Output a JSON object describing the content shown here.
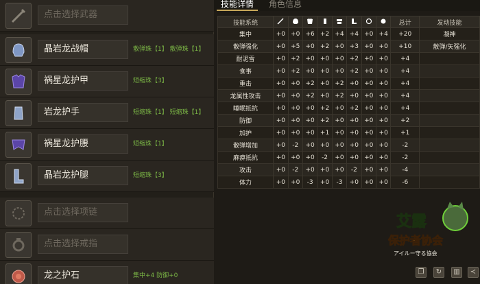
{
  "equipment": [
    {
      "name": "点击选择武器",
      "empty": true,
      "deco": ""
    },
    {
      "name": "晶岩龙战帽",
      "empty": false,
      "deco": "散弹珠【1】 散弹珠【1】"
    },
    {
      "name": "祸星龙护甲",
      "empty": false,
      "deco": "短缩珠【3】"
    },
    {
      "name": "岩龙护手",
      "empty": false,
      "deco": "短缩珠【1】 短缩珠【1】"
    },
    {
      "name": "祸星龙护腰",
      "empty": false,
      "deco": "短缩珠【1】"
    },
    {
      "name": "晶岩龙护腿",
      "empty": false,
      "deco": "短缩珠【3】"
    },
    {
      "name": "点击选择项链",
      "empty": true,
      "deco": ""
    },
    {
      "name": "点击选择戒指",
      "empty": true,
      "deco": ""
    },
    {
      "name": "龙之护石",
      "empty": false,
      "deco": "集中+4 防御+0"
    }
  ],
  "tabs": {
    "active": "技能详情",
    "inactive": "角色信息"
  },
  "table": {
    "header_skill": "技能系统",
    "header_total": "总计",
    "header_activation": "发动技能",
    "part_icons": [
      "weapon-icon",
      "helmet-icon",
      "armor-icon",
      "gloves-icon",
      "waist-icon",
      "legs-icon",
      "talisman-icon",
      "necklace-icon"
    ],
    "rows": [
      {
        "skill": "集中",
        "parts": [
          "+0",
          "+0",
          "+6",
          "+2",
          "+4",
          "+4",
          "+0",
          "+4"
        ],
        "total": "+20",
        "activation": "凝神"
      },
      {
        "skill": "散弹强化",
        "parts": [
          "+0",
          "+5",
          "+0",
          "+2",
          "+0",
          "+3",
          "+0",
          "+0"
        ],
        "total": "+10",
        "activation": "散弹/矢强化"
      },
      {
        "skill": "耐泥雪",
        "parts": [
          "+0",
          "+2",
          "+0",
          "+0",
          "+0",
          "+2",
          "+0",
          "+0"
        ],
        "total": "+4",
        "activation": ""
      },
      {
        "skill": "食事",
        "parts": [
          "+0",
          "+2",
          "+0",
          "+0",
          "+0",
          "+2",
          "+0",
          "+0"
        ],
        "total": "+4",
        "activation": ""
      },
      {
        "skill": "重击",
        "parts": [
          "+0",
          "+0",
          "+2",
          "+0",
          "+2",
          "+0",
          "+0",
          "+0"
        ],
        "total": "+4",
        "activation": ""
      },
      {
        "skill": "龙属性攻击",
        "parts": [
          "+0",
          "+0",
          "+2",
          "+0",
          "+2",
          "+0",
          "+0",
          "+0"
        ],
        "total": "+4",
        "activation": ""
      },
      {
        "skill": "睡眠抵抗",
        "parts": [
          "+0",
          "+0",
          "+0",
          "+2",
          "+0",
          "+2",
          "+0",
          "+0"
        ],
        "total": "+4",
        "activation": ""
      },
      {
        "skill": "防御",
        "parts": [
          "+0",
          "+0",
          "+0",
          "+2",
          "+0",
          "+0",
          "+0",
          "+0"
        ],
        "total": "+2",
        "activation": ""
      },
      {
        "skill": "加护",
        "parts": [
          "+0",
          "+0",
          "+0",
          "+1",
          "+0",
          "+0",
          "+0",
          "+0"
        ],
        "total": "+1",
        "activation": ""
      },
      {
        "skill": "散弹增加",
        "parts": [
          "+0",
          "-2",
          "+0",
          "+0",
          "+0",
          "+0",
          "+0",
          "+0"
        ],
        "total": "-2",
        "activation": ""
      },
      {
        "skill": "麻痹抵抗",
        "parts": [
          "+0",
          "+0",
          "+0",
          "-2",
          "+0",
          "+0",
          "+0",
          "+0"
        ],
        "total": "-2",
        "activation": ""
      },
      {
        "skill": "攻击",
        "parts": [
          "+0",
          "-2",
          "+0",
          "+0",
          "+0",
          "-2",
          "+0",
          "+0"
        ],
        "total": "-4",
        "activation": ""
      },
      {
        "skill": "体力",
        "parts": [
          "+0",
          "+0",
          "-3",
          "+0",
          "-3",
          "+0",
          "+0",
          "+0"
        ],
        "total": "-6",
        "activation": ""
      }
    ]
  },
  "logo": {
    "title": "艾露",
    "subtitle": "保护者协会",
    "tagline": "アイルー守る協会"
  },
  "bottom_buttons": [
    "copy-icon",
    "refresh-icon",
    "delete-icon",
    "share-icon"
  ],
  "colors": {
    "deco_text": "#7ab445",
    "logo_green": "#6fcf3a",
    "logo_orange": "#f0a030",
    "accent": "#c8a85a"
  }
}
